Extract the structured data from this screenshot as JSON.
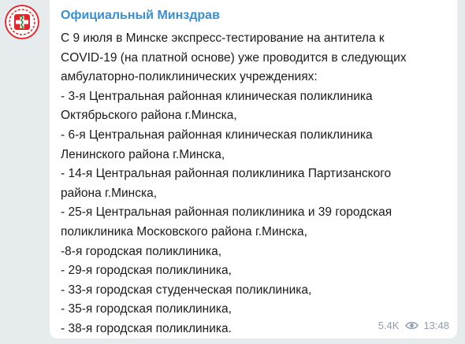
{
  "channel": {
    "name": "Официальный Минздрав",
    "avatar_icon": "ministry-emblem-icon",
    "avatar_colors": {
      "red": "#e3262b",
      "green": "#1f8a3a"
    }
  },
  "message": {
    "lines": [
      "С 9 июля в Минске экспресс-тестирование на антитела к",
      "COVID-19 (на платной основе) уже проводится в следующих",
      "амбулаторно-поликлинических учреждениях:",
      "- 3-я Центральная районная клиническая поликлиника",
      "Октябрьского района г.Минска,",
      "- 6-я Центральная районная клиническая поликлиника",
      "Ленинского района г.Минска,",
      "- 14-я Центральная районная поликлиника Партизанского",
      "района г.Минска,",
      "- 25-я Центральная районная поликлиника и 39 городская",
      "поликлиника Московского района г.Минска,",
      "-8-я городская поликлиника,",
      "- 29-я городская поликлиника,",
      "- 33-я городская студенческая поликлиника,",
      "- 35-я городская поликлиника,",
      "- 38-я городская поликлиника."
    ],
    "views": "5.4K",
    "views_icon": "eye-icon",
    "time": "13:48"
  },
  "colors": {
    "background": "#e6ebee",
    "bubble": "#ffffff",
    "sender": "#3a8fd1",
    "text": "#1b1b1b",
    "meta": "#8ea1af"
  }
}
